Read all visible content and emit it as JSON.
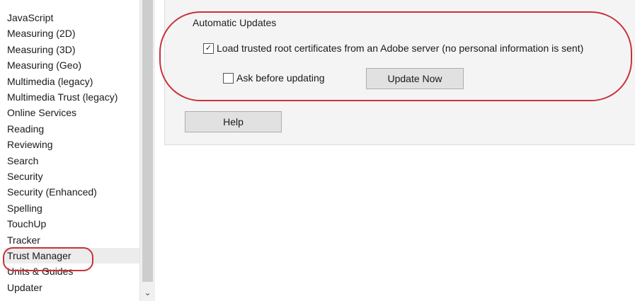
{
  "sidebar": {
    "items": [
      {
        "label": "JavaScript"
      },
      {
        "label": "Measuring (2D)"
      },
      {
        "label": "Measuring (3D)"
      },
      {
        "label": "Measuring (Geo)"
      },
      {
        "label": "Multimedia (legacy)"
      },
      {
        "label": "Multimedia Trust (legacy)"
      },
      {
        "label": "Online Services"
      },
      {
        "label": "Reading"
      },
      {
        "label": "Reviewing"
      },
      {
        "label": "Search"
      },
      {
        "label": "Security"
      },
      {
        "label": "Security (Enhanced)"
      },
      {
        "label": "Spelling"
      },
      {
        "label": "TouchUp"
      },
      {
        "label": "Tracker"
      },
      {
        "label": "Trust Manager",
        "selected": true
      },
      {
        "label": "Units & Guides"
      },
      {
        "label": "Updater"
      }
    ],
    "scroll_down_glyph": "⌄"
  },
  "automatic_updates": {
    "title": "Automatic Updates",
    "load_certs": {
      "label": "Load trusted root certificates from an Adobe server (no personal information is sent)",
      "checked": true
    },
    "ask_before": {
      "label": "Ask before updating",
      "checked": false
    },
    "update_now_label": "Update Now"
  },
  "help_label": "Help",
  "colors": {
    "annotation": "#c8323b",
    "panel_bg": "#f4f4f4",
    "selected_bg": "#ececec"
  }
}
